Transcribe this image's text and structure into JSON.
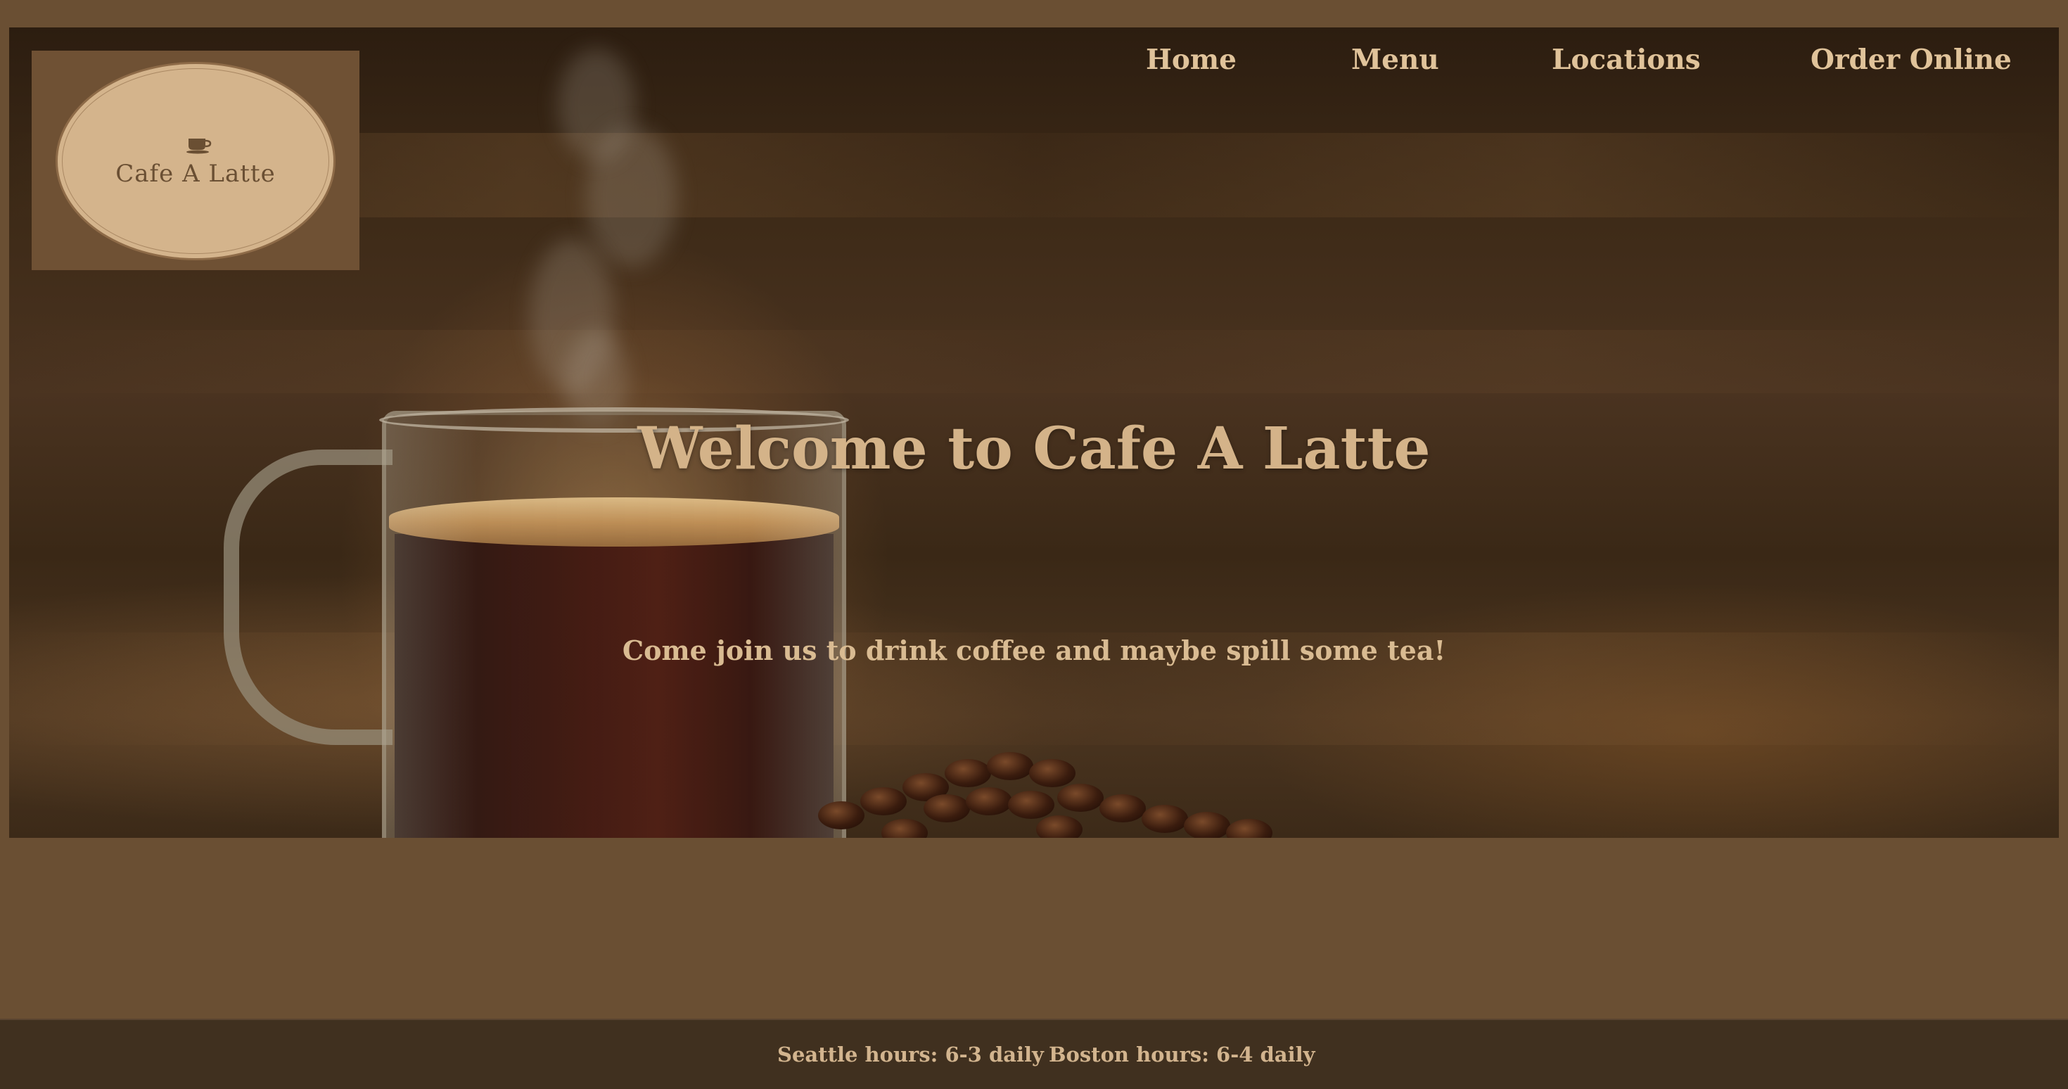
{
  "logo": {
    "text": "Cafe A Latte",
    "icon": "coffee-cup-icon"
  },
  "nav": {
    "items": [
      {
        "label": "Home"
      },
      {
        "label": "Menu"
      },
      {
        "label": "Locations"
      },
      {
        "label": "Order Online"
      }
    ]
  },
  "hero": {
    "title": "Welcome to Cafe A Latte",
    "subtitle": "Come join us to drink coffee and maybe spill some tea!"
  },
  "footer": {
    "seattle_hours": "Seattle hours: 6-3 daily",
    "boston_hours": "Boston hours: 6-4 daily"
  },
  "colors": {
    "page_background": "#6a4f33",
    "accent_text": "#d4b389",
    "footer_background": "#40301f",
    "logo_badge": "#d4b48c"
  }
}
